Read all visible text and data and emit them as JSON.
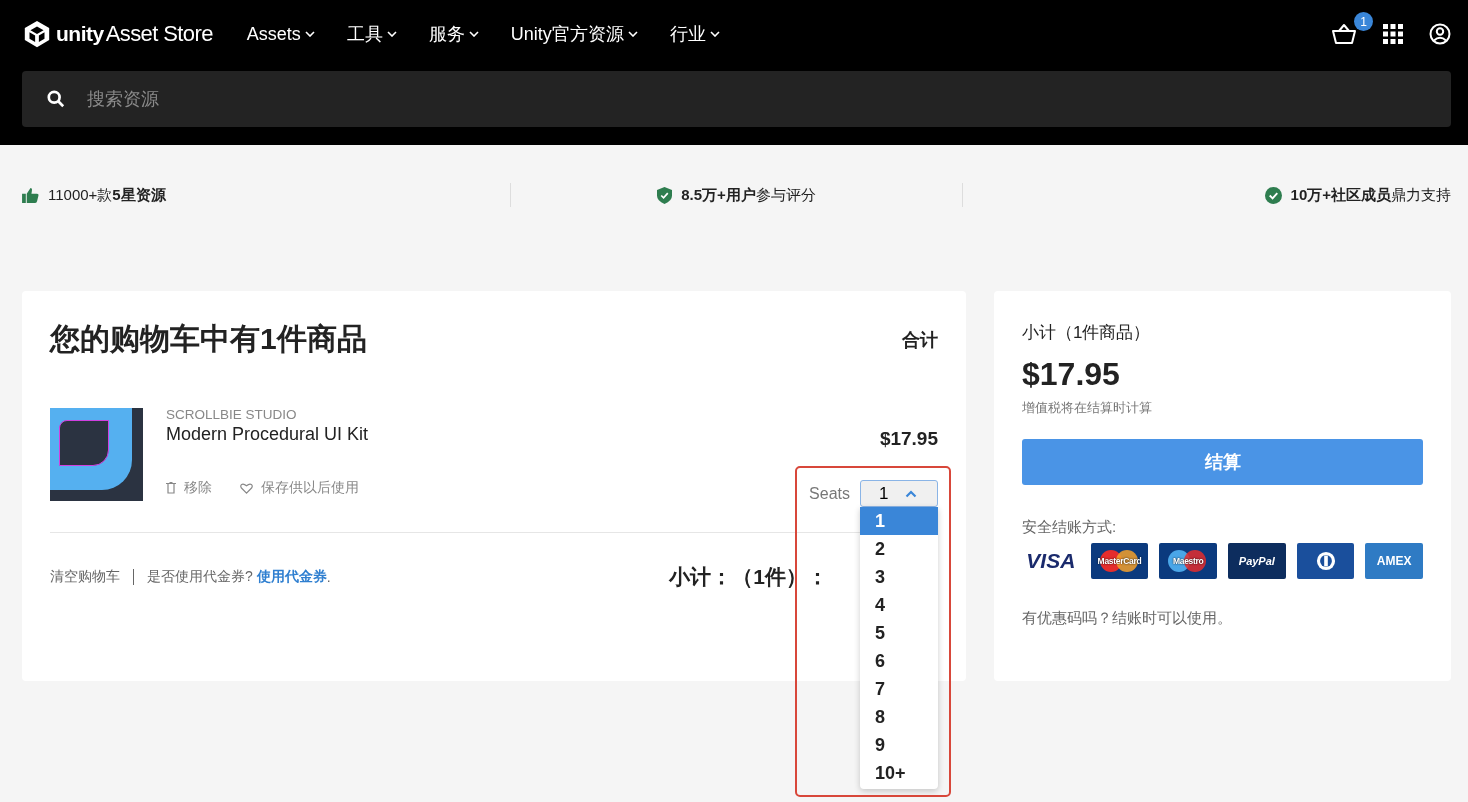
{
  "header": {
    "logo": {
      "brand": "unity",
      "name": "Asset Store"
    },
    "nav": [
      {
        "label": "Assets"
      },
      {
        "label": "工具"
      },
      {
        "label": "服务"
      },
      {
        "label": "Unity官方资源"
      },
      {
        "label": "行业"
      }
    ],
    "cart_count": "1"
  },
  "search": {
    "placeholder": "搜索资源"
  },
  "highlights": [
    {
      "kind": "thumb",
      "text": "11000+款**5星资源**"
    },
    {
      "kind": "shield",
      "text": "**8.5万+用户**参与评分"
    },
    {
      "kind": "check",
      "text": "**10万+社区成员**鼎力支持"
    }
  ],
  "cart": {
    "title": "您的购物车中有1件商品",
    "total_heading": "合计",
    "items": [
      {
        "publisher": "SCROLLBIE STUDIO",
        "name": "Modern Procedural UI Kit",
        "price": "$17.95",
        "actions": [
          {
            "kind": "remove",
            "label": "移除"
          },
          {
            "kind": "save",
            "label": "保存供以后使用"
          }
        ],
        "seats_label": "Seats",
        "seats_value": "1",
        "seats_expanded": true,
        "seats_options": [
          {
            "label": "1",
            "selected": true
          },
          {
            "label": "2",
            "selected": false
          },
          {
            "label": "3",
            "selected": false
          },
          {
            "label": "4",
            "selected": false
          },
          {
            "label": "5",
            "selected": false
          },
          {
            "label": "6",
            "selected": false
          },
          {
            "label": "7",
            "selected": false
          },
          {
            "label": "8",
            "selected": false
          },
          {
            "label": "9",
            "selected": false
          },
          {
            "label": "10+",
            "selected": false
          }
        ]
      }
    ],
    "footer": {
      "clear": "清空购物车",
      "coupon_question": "是否使用代金券?",
      "coupon_link": "使用代金券",
      "coupon_end": ".",
      "subtotal": "小计：（1件）："
    }
  },
  "summary": {
    "heading": "小计（1件商品）",
    "price": "$17.95",
    "tax_note": "增值税将在结算时计算",
    "checkout": "结算",
    "payment_heading": "安全结账方式:",
    "payment_methods": [
      {
        "kind": "visa",
        "label": "VISA"
      },
      {
        "kind": "mastercard",
        "label": "MasterCard"
      },
      {
        "kind": "maestro",
        "label": "Maestro"
      },
      {
        "kind": "paypal",
        "label": "PayPal"
      },
      {
        "kind": "diners"
      },
      {
        "kind": "amex",
        "label": "AMEX"
      }
    ],
    "promo_note": "有优惠码吗？结账时可以使用。"
  }
}
